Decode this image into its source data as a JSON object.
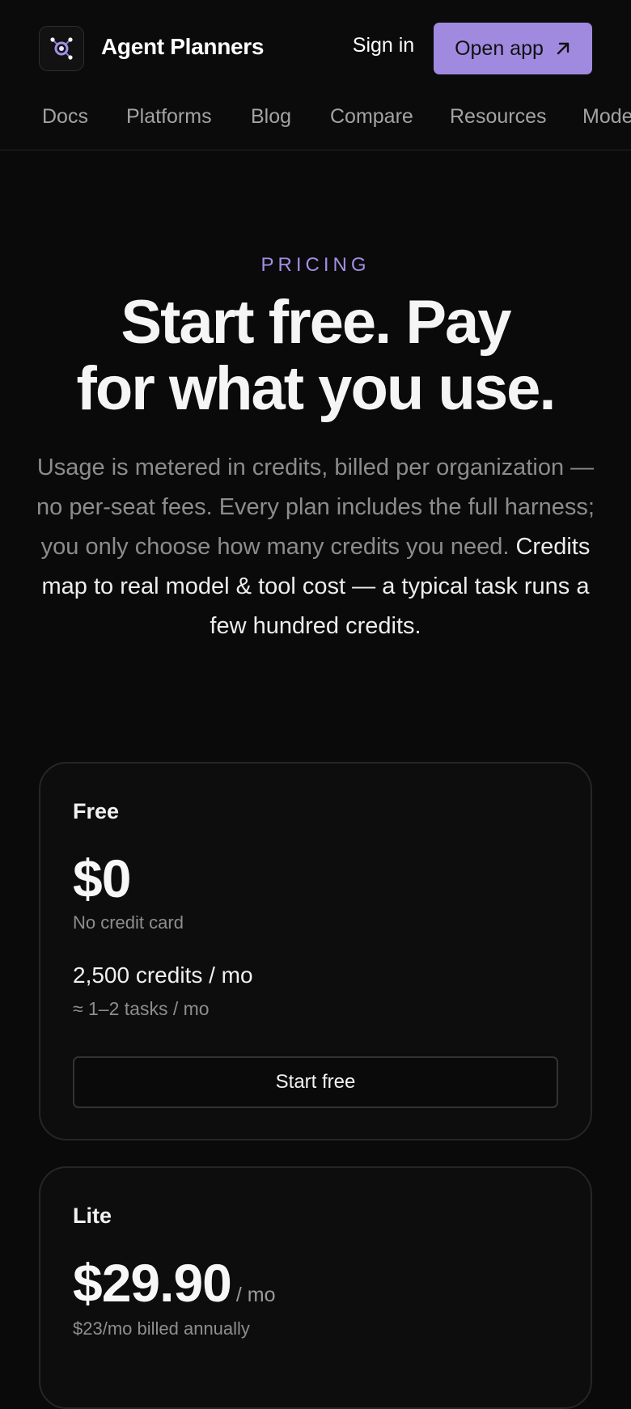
{
  "header": {
    "brand": "Agent Planners",
    "sign_in": "Sign in",
    "open_app": "Open app",
    "logo_icon": "orbit-node-icon",
    "open_app_icon": "arrow-up-right-icon",
    "accent_color": "#a08ae0"
  },
  "nav": {
    "items": [
      {
        "label": "Docs"
      },
      {
        "label": "Platforms"
      },
      {
        "label": "Blog"
      },
      {
        "label": "Compare"
      },
      {
        "label": "Resources"
      },
      {
        "label": "Models"
      }
    ]
  },
  "hero": {
    "eyebrow": "PRICING",
    "title_line1": "Start free. Pay",
    "title_line2": "for what you use.",
    "lede_muted": "Usage is metered in credits, billed per organization — no per-seat fees. Every plan includes the full harness; you only choose how many credits you need.",
    "lede_highlight": "Credits map to real model & tool cost — a typical task runs a few hundred credits."
  },
  "plans": [
    {
      "name": "Free",
      "price": "$0",
      "note": "No credit card",
      "credits": "2,500 credits / mo",
      "tasks": "≈ 1–2 tasks / mo",
      "cta": "Start free"
    },
    {
      "name": "Lite",
      "price": "$29.90",
      "per": "/ mo",
      "note": "$23/mo billed annually"
    }
  ]
}
